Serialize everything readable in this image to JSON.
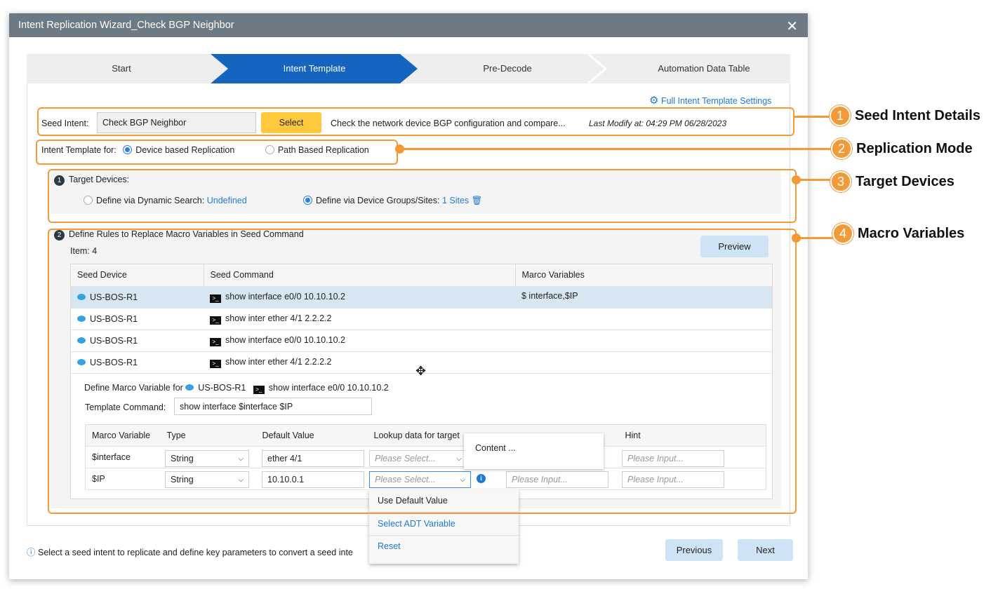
{
  "window": {
    "title": "Intent Replication Wizard_Check BGP Neighbor"
  },
  "steps": [
    {
      "label": "Start"
    },
    {
      "label": "Intent Template"
    },
    {
      "label": "Pre-Decode"
    },
    {
      "label": "Automation Data Table"
    }
  ],
  "settings_link": "Full Intent Template Settings",
  "seed": {
    "label": "Seed Intent:",
    "value": "Check BGP Neighbor",
    "select_label": "Select",
    "description": "Check the network device BGP configuration and compare...",
    "last_modify": "Last Modify at: 04:29 PM 06/28/2023"
  },
  "template_for": {
    "label": "Intent Template for:",
    "options": [
      {
        "label": "Device based Replication",
        "selected": true
      },
      {
        "label": "Path Based Replication",
        "selected": false
      }
    ]
  },
  "target": {
    "num": "1",
    "title": "Target Devices:",
    "dynamic_label": "Define via Dynamic Search:",
    "dynamic_value": "Undefined",
    "groups_label": "Define via Device Groups/Sites:",
    "groups_value": "1 Sites",
    "selected": "groups"
  },
  "rules": {
    "num": "2",
    "title": "Define Rules to Replace Macro Variables in Seed Command",
    "item_count": "Item: 4",
    "preview_label": "Preview",
    "columns": [
      "Seed Device",
      "Seed Command",
      "Marco Variables"
    ],
    "rows": [
      {
        "device": "US-BOS-R1",
        "command": "show interface e0/0 10.10.10.2",
        "vars": "$ interface,$IP",
        "selected": true
      },
      {
        "device": "US-BOS-R1",
        "command": "show inter ether 4/1 2.2.2.2",
        "vars": ""
      },
      {
        "device": "US-BOS-R1",
        "command": "show interface e0/0 10.10.10.2",
        "vars": ""
      },
      {
        "device": "US-BOS-R1",
        "command": "show inter ether 4/1 2.2.2.2",
        "vars": ""
      }
    ],
    "define_for_label": "Define Marco Variable for",
    "define_device": "US-BOS-R1",
    "define_command": "show interface e0/0 10.10.10.2",
    "template_label": "Template Command:",
    "template_value": "show interface $interface  $IP",
    "var_columns": [
      "Marco Variable",
      "Type",
      "Default Value",
      "Lookup data for target",
      "",
      "Hint"
    ],
    "var_rows": [
      {
        "name": "$interface",
        "type": "String",
        "default": "ether 4/1",
        "lookup": "Please Select...",
        "hint": "Please Input..."
      },
      {
        "name": "$IP",
        "type": "String",
        "default": "10.10.0.1",
        "lookup": "Please Select...",
        "extra": "Please Input...",
        "hint": "Please Input..."
      }
    ],
    "tooltip": "Content ...",
    "menu": [
      "Use Default Value",
      "Select ADT Variable",
      "Reset"
    ]
  },
  "footer": {
    "info": "Select a seed intent to replicate and define key parameters to convert a seed inte",
    "previous": "Previous",
    "next": "Next"
  },
  "annotations": [
    {
      "num": "1",
      "label": "Seed Intent Details"
    },
    {
      "num": "2",
      "label": "Replication Mode"
    },
    {
      "num": "3",
      "label": "Target Devices"
    },
    {
      "num": "4",
      "label": "Macro Variables"
    }
  ],
  "colors": {
    "accent": "#1565c0",
    "annotation": "#f29a38",
    "select_button": "#ffc83d",
    "titlebar": "#6e7a83"
  }
}
